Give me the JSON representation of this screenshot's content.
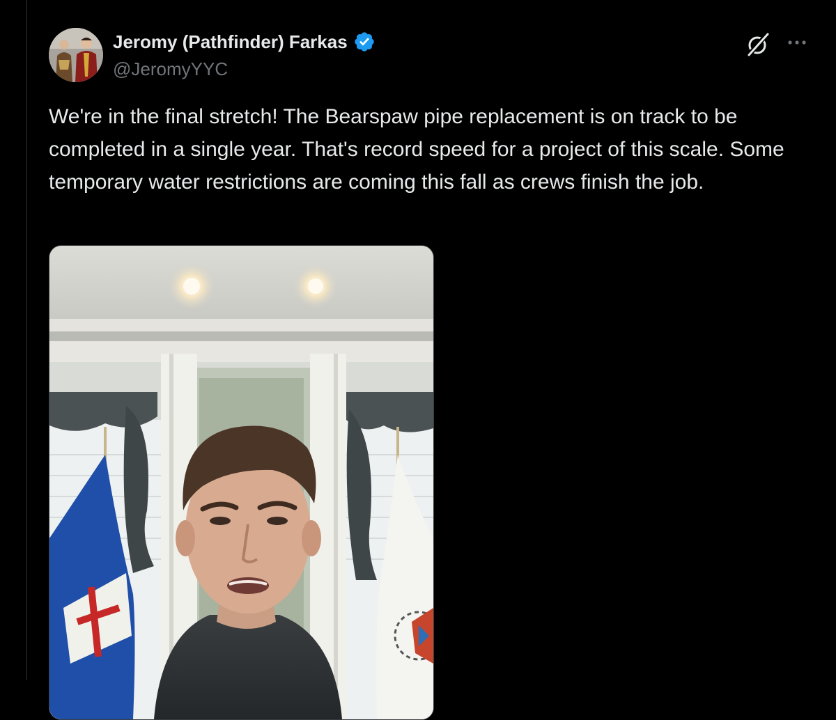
{
  "author": {
    "display_name": "Jeromy (Pathfinder) Farkas",
    "handle": "@JeromyYYC",
    "verified": true
  },
  "post": {
    "text": "We're in the final stretch! The Bearspaw pipe replacement is on track to be completed in a single year. That's record speed for a project of this scale. Some temporary water restrictions are coming this fall as crews finish the job."
  },
  "icons": {
    "verified": "verified-badge-icon",
    "grok": "grok-icon",
    "more": "more-options-icon"
  },
  "colors": {
    "background": "#000000",
    "text_primary": "#e7e9ea",
    "text_secondary": "#71767b",
    "verified_blue": "#1d9bf0",
    "divider": "#2f3336"
  }
}
